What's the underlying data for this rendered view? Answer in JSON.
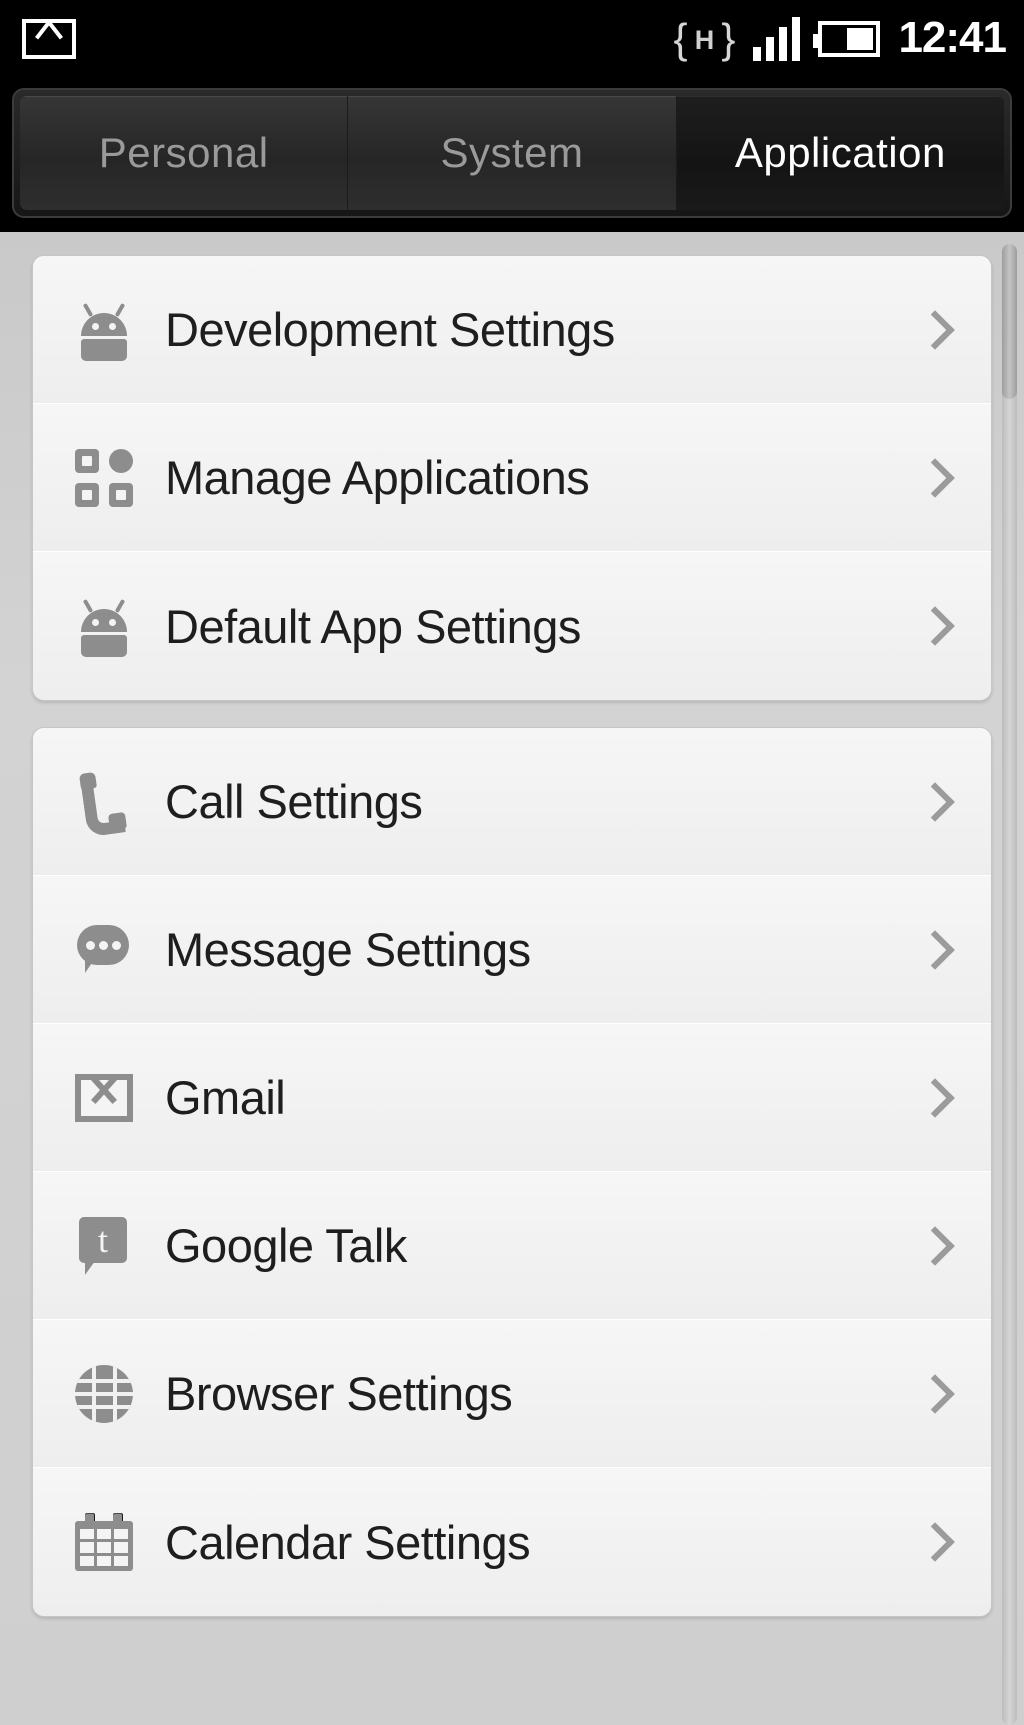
{
  "status_bar": {
    "notification_icon": "envelope-icon",
    "network_type": "H",
    "signal_bars": 4,
    "battery_icon": "battery-icon",
    "clock": "12:41"
  },
  "tabs": [
    {
      "label": "Personal",
      "selected": false
    },
    {
      "label": "System",
      "selected": false
    },
    {
      "label": "Application",
      "selected": true
    }
  ],
  "groups": [
    {
      "items": [
        {
          "label": "Development Settings",
          "icon": "android-robot-icon",
          "chevron": "chevron-right-icon"
        },
        {
          "label": "Manage Applications",
          "icon": "app-grid-icon",
          "chevron": "chevron-right-icon"
        },
        {
          "label": "Default App Settings",
          "icon": "android-robot-icon",
          "chevron": "chevron-right-icon"
        }
      ]
    },
    {
      "items": [
        {
          "label": "Call Settings",
          "icon": "phone-handset-icon",
          "chevron": "chevron-right-icon"
        },
        {
          "label": "Message Settings",
          "icon": "speech-bubble-icon",
          "chevron": "chevron-right-icon"
        },
        {
          "label": "Gmail",
          "icon": "envelope-icon",
          "chevron": "chevron-right-icon"
        },
        {
          "label": "Google Talk",
          "icon": "talk-bubble-icon",
          "chevron": "chevron-right-icon",
          "glyph": "t"
        },
        {
          "label": "Browser Settings",
          "icon": "globe-icon",
          "chevron": "chevron-right-icon"
        },
        {
          "label": "Calendar Settings",
          "icon": "calendar-icon",
          "chevron": "chevron-right-icon"
        }
      ]
    }
  ],
  "colors": {
    "status_bar_bg": "#000000",
    "tab_selected_text": "#ffffff",
    "tab_text": "#9a9a9a",
    "list_bg": "#cfcfcf",
    "card_bg": "#f2f2f2",
    "label_text": "#1e1e1e",
    "icon_gray": "#8d8d8d",
    "chevron_gray": "#9b9b9b"
  },
  "scrollbar": {
    "name": "vertical-scrollbar",
    "position": "top"
  }
}
